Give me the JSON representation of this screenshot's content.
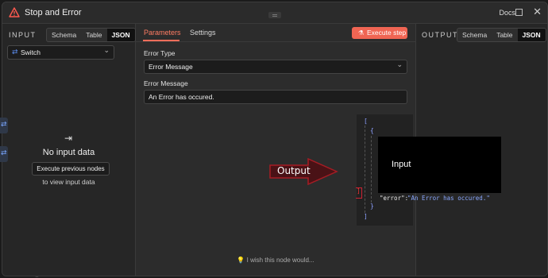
{
  "background": {
    "ghost_text": "Settings"
  },
  "modal": {
    "title": "Stop and Error",
    "docs_label": "Docs",
    "close_glyph": "✕"
  },
  "input_panel": {
    "title": "INPUT",
    "views": [
      "Schema",
      "Table",
      "JSON"
    ],
    "active_view": "JSON",
    "node_select": "Switch",
    "empty_title": "No input data",
    "exec_prev_label": "Execute previous nodes",
    "empty_sub": "to view input data"
  },
  "parameters_panel": {
    "tabs": [
      "Parameters",
      "Settings"
    ],
    "active_tab": "Parameters",
    "execute_label": "Execute step",
    "fields": [
      {
        "label": "Error Type",
        "value": "Error Message",
        "type": "select"
      },
      {
        "label": "Error Message",
        "value": "An Error has occured.",
        "type": "text"
      }
    ],
    "wish_text": "I wish this node would..."
  },
  "output_panel": {
    "title": "OUTPUT",
    "views": [
      "Schema",
      "Table",
      "JSON"
    ],
    "active_view": "JSON"
  },
  "json_preview": {
    "open_bracket": "[",
    "open_brace": "{",
    "key": "\"error\":",
    "value": "\"An Error has occured.\"",
    "close_brace": "}",
    "close_bracket": "]"
  },
  "annotations": {
    "arrow_label": "Output",
    "box_label": "Input"
  },
  "colors": {
    "accent": "#f06553",
    "warning_icon": "#ff5a4f",
    "switch_icon": "#5b8def",
    "json_string": "#8aa8ff",
    "arrow": "#a51c24"
  }
}
